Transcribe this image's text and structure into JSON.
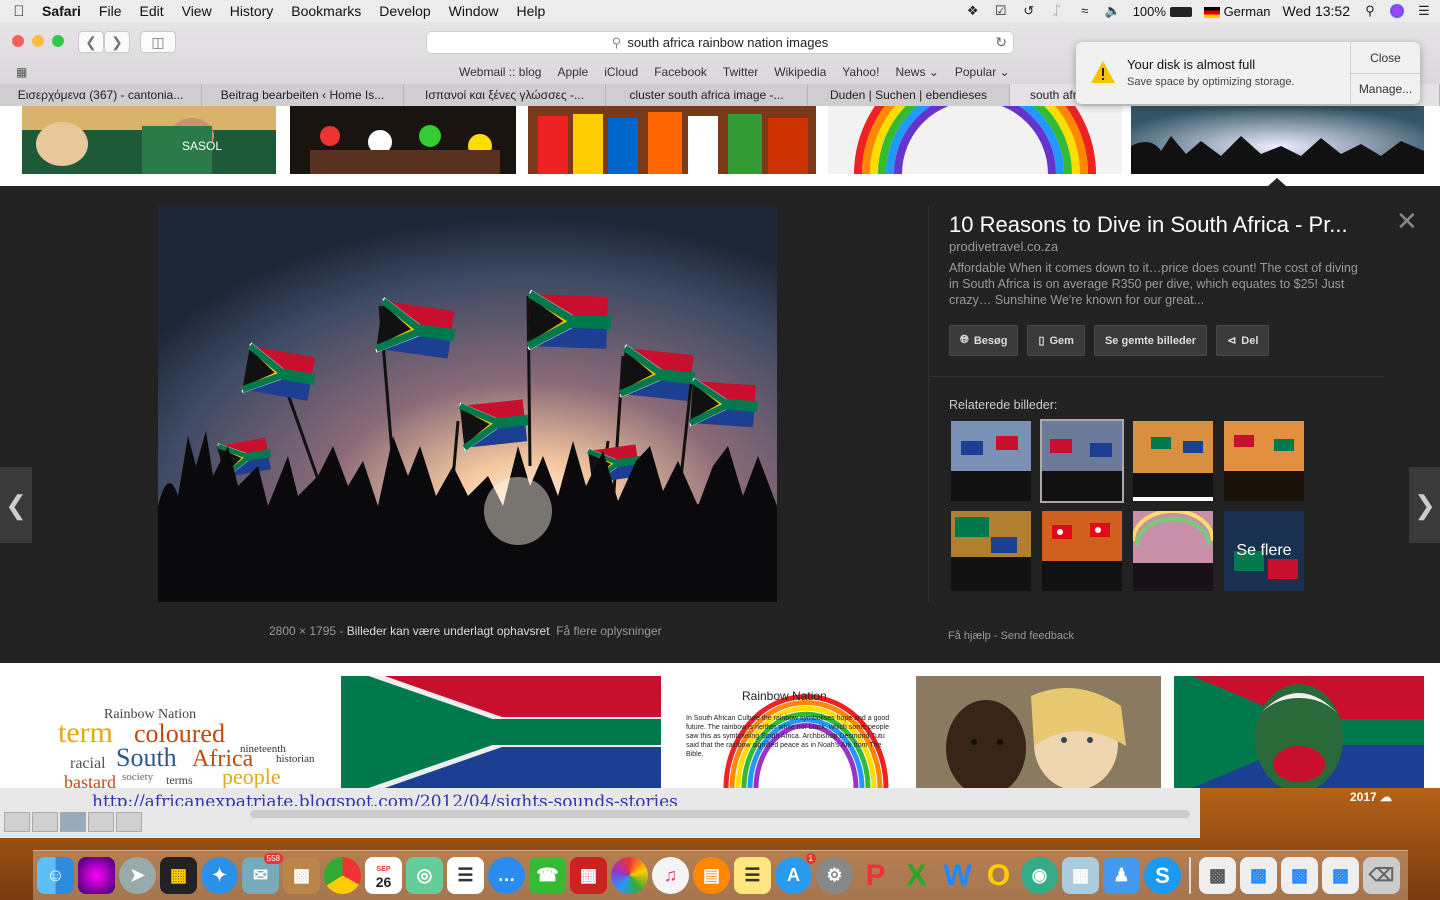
{
  "menubar": {
    "app": "Safari",
    "menus": [
      "File",
      "Edit",
      "View",
      "History",
      "Bookmarks",
      "Develop",
      "Window",
      "Help"
    ],
    "battery": "100%",
    "input_source": "German",
    "clock": "Wed 13:52"
  },
  "browser": {
    "address": "south africa rainbow nation images",
    "favorites": [
      "Webmail :: blog",
      "Apple",
      "iCloud",
      "Facebook",
      "Twitter",
      "Wikipedia",
      "Yahoo!",
      "News ⌄",
      "Popular ⌄"
    ],
    "tabs": [
      "Εισερχόμενα (367) - cantonia...",
      "Beitrag bearbeiten ‹ Home Is...",
      "Ισπανοί και ξένες γλώσσες -...",
      "cluster south africa image -...",
      "Duden | Suchen | ebendieses",
      "south afr"
    ]
  },
  "notification": {
    "title": "Your disk is almost full",
    "message": "Save space by optimizing storage.",
    "close_label": "Close",
    "manage_label": "Manage..."
  },
  "result": {
    "title": "10 Reasons to Dive in South Africa - Pr...",
    "site": "prodivetravel.co.za",
    "description": "Affordable When it comes down to it…price does count! The cost of diving in South Africa is on average R350 per dive, which equates to $25! Just crazy… Sunshine We're known for our great...",
    "buttons": {
      "visit": "Besøg",
      "save": "Gem",
      "saved": "Se gemte billeder",
      "share": "Del"
    },
    "related_label": "Relaterede billeder:",
    "see_more": "Se flere",
    "help": "Få hjælp",
    "feedback": "Send feedback",
    "dimensions": "2800 × 1795",
    "copyright": "Billeder kan være underlagt ophavsret",
    "more_info": "Få flere oplysninger"
  },
  "background": {
    "editor_url": "http://africanexpatriate.blogspot.com/2012/04/sights-sounds-stories",
    "year": "2017"
  },
  "wordcloud": {
    "words": [
      "Rainbow Nation",
      "term",
      "coloured",
      "South",
      "Africa",
      "people",
      "racial",
      "terms",
      "nineteenth",
      "historian",
      "society",
      "bastard"
    ]
  },
  "rainbow_card": {
    "title": "Rainbow Nation",
    "text": "In South African Culture the rainbow symbolises hope and a good future. The rainbow is neither white nor black, which some people saw this as symbolising South Africa. Archbishop Desmond Tutu said that the rainbow signified peace as in Noah's Ark from The Bible."
  },
  "dock": {
    "badge_mail": "558",
    "calendar_month": "SEP",
    "calendar_day": "26",
    "badge_appstore": "1"
  }
}
